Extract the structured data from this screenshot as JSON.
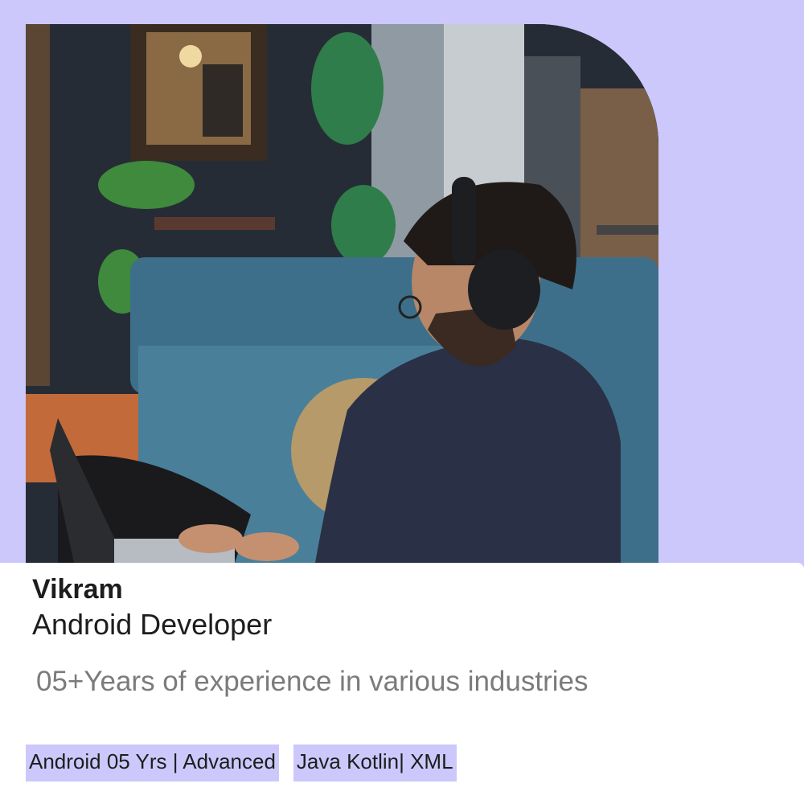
{
  "profile": {
    "name": "Vikram",
    "role": "Android Developer",
    "experience": "05+Years of experience in various industries"
  },
  "tags": [
    {
      "label": "Android 05 Yrs | Advanced"
    },
    {
      "label": "Java Kotlin| XML"
    }
  ],
  "colors": {
    "background": "#ccc8fb",
    "tag_background": "#ccc8fb",
    "text_primary": "#1d1d1d",
    "text_secondary": "#7b7b7b"
  }
}
